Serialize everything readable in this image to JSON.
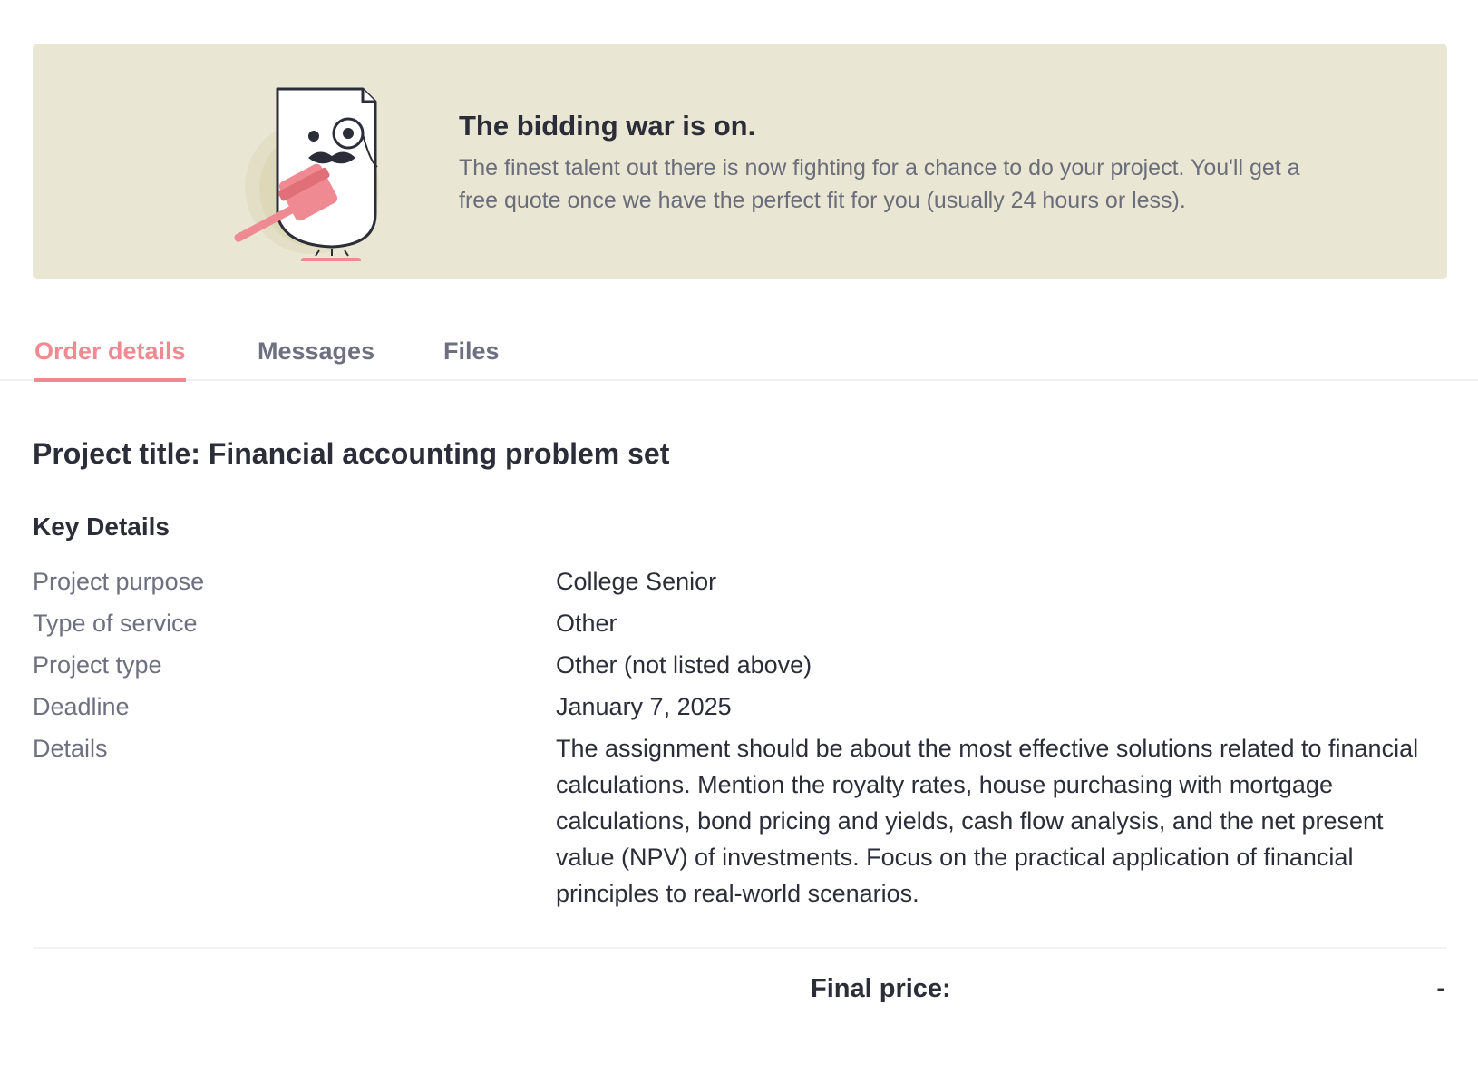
{
  "banner": {
    "title": "The bidding war is on.",
    "body": "The finest talent out there is now fighting for a chance to do your project. You'll get a free quote once we have the perfect fit for you (usually 24 hours or less).",
    "illustration_icon": "gavel-document-mascot-icon"
  },
  "tabs": [
    {
      "label": "Order details",
      "active": true
    },
    {
      "label": "Messages",
      "active": false
    },
    {
      "label": "Files",
      "active": false
    }
  ],
  "project": {
    "title": "Project title: Financial accounting problem set"
  },
  "key_details": {
    "heading": "Key Details",
    "rows": [
      {
        "label": "Project purpose",
        "value": "College Senior"
      },
      {
        "label": "Type of service",
        "value": "Other"
      },
      {
        "label": "Project type",
        "value": "Other (not listed above)"
      },
      {
        "label": "Deadline",
        "value": "January 7, 2025"
      },
      {
        "label": "Details",
        "value": "The assignment should be about the most effective solutions related to financial calculations. Mention the royalty rates, house purchasing with mortgage calculations, bond pricing and yields, cash flow analysis, and the net present value (NPV) of investments. Focus on the practical application of financial principles to real-world scenarios."
      }
    ]
  },
  "price": {
    "label": "Final price:",
    "value": "-"
  },
  "colors": {
    "accent": "#f08a92",
    "banner_bg": "#e9e6d4",
    "text_primary": "#2b2d38",
    "text_secondary": "#6e7080"
  }
}
